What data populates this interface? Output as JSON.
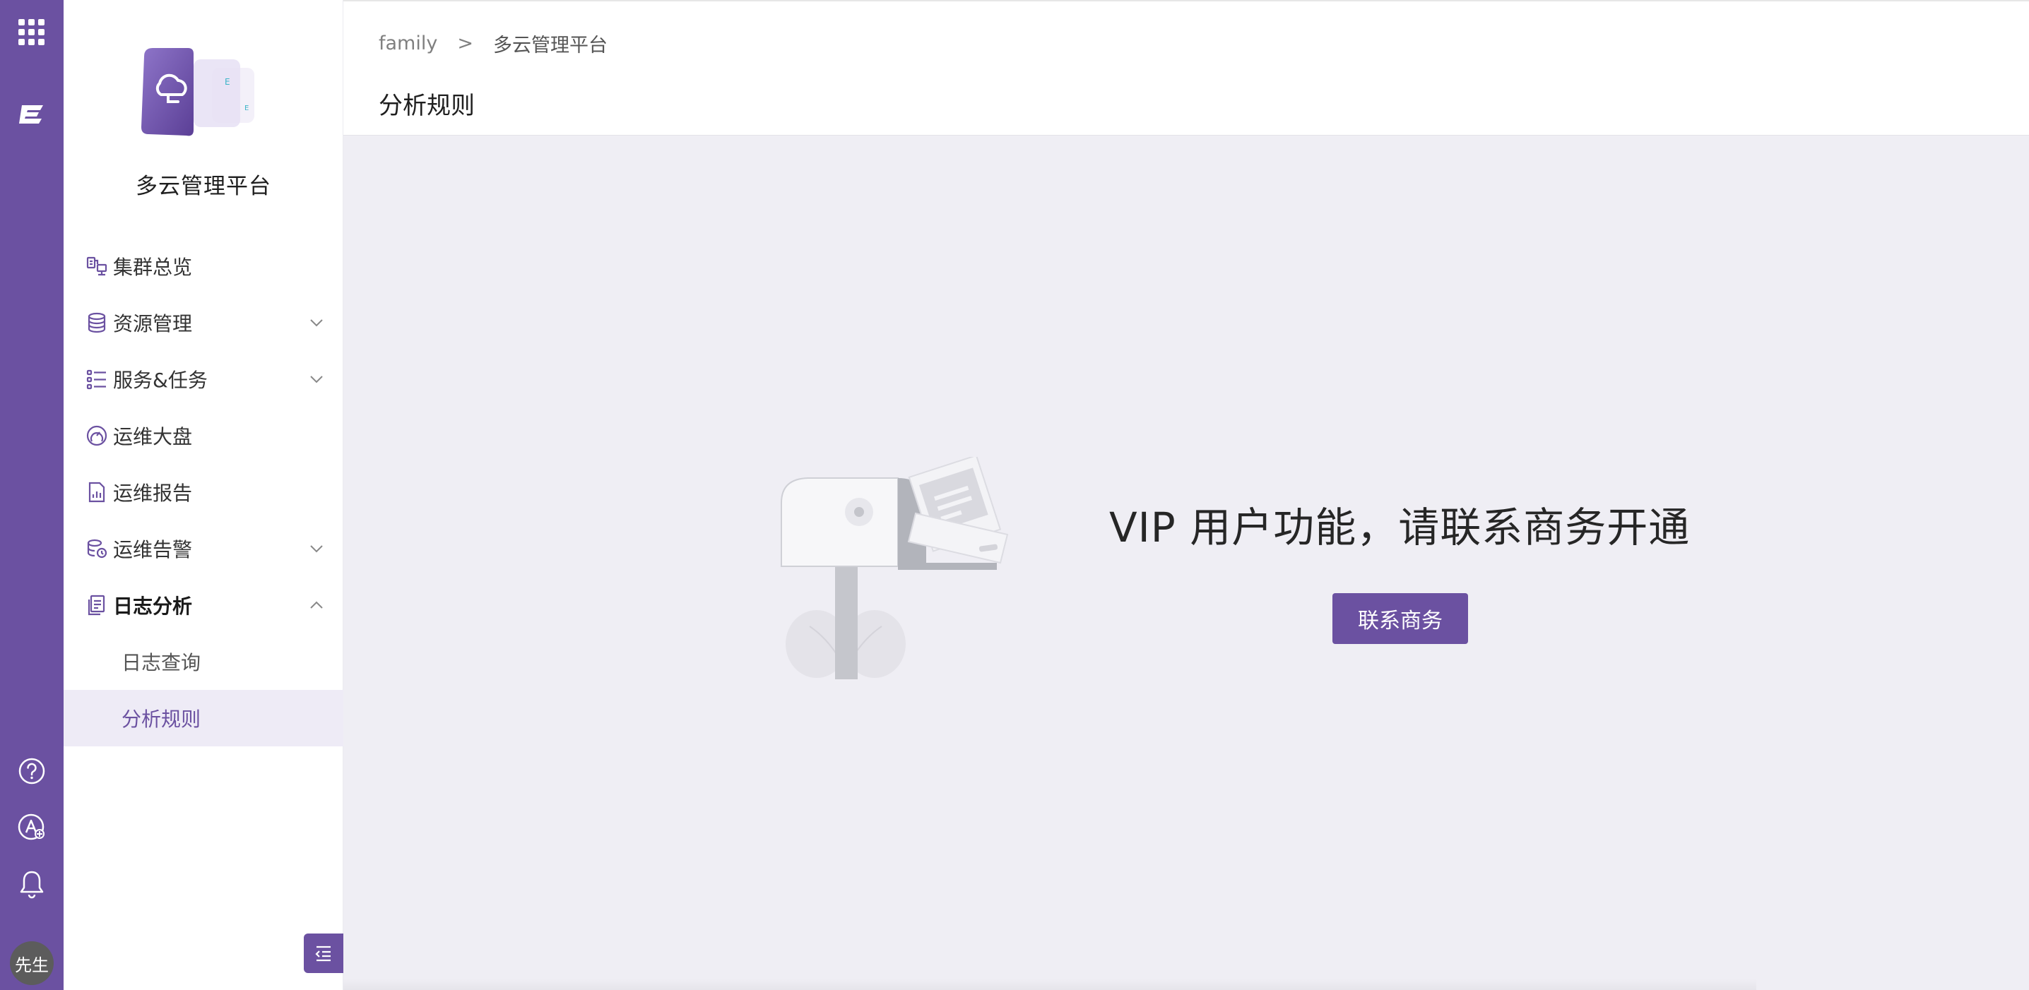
{
  "rail": {
    "avatar_text": "先生",
    "logo_letter": "E"
  },
  "sidebar": {
    "platform_name": "多云管理平台",
    "items": [
      {
        "label": "集群总览",
        "icon": "cluster-icon",
        "expandable": false
      },
      {
        "label": "资源管理",
        "icon": "database-icon",
        "expandable": true,
        "expanded": false
      },
      {
        "label": "服务&任务",
        "icon": "list-icon",
        "expandable": true,
        "expanded": false
      },
      {
        "label": "运维大盘",
        "icon": "dashboard-icon",
        "expandable": false
      },
      {
        "label": "运维报告",
        "icon": "report-icon",
        "expandable": false
      },
      {
        "label": "运维告警",
        "icon": "alarm-icon",
        "expandable": true,
        "expanded": false
      },
      {
        "label": "日志分析",
        "icon": "log-icon",
        "expandable": true,
        "expanded": true,
        "children": [
          {
            "label": "日志查询",
            "active": false
          },
          {
            "label": "分析规则",
            "active": true
          }
        ]
      }
    ]
  },
  "header": {
    "breadcrumb": [
      "family",
      "多云管理平台"
    ],
    "breadcrumb_separator": ">",
    "title": "分析规则"
  },
  "main": {
    "message": "VIP 用户功能，请联系商务开通",
    "button_label": "联系商务"
  },
  "colors": {
    "brand": "#6b51a1",
    "active_bg": "#eeebf6",
    "content_bg": "#efeef4"
  }
}
